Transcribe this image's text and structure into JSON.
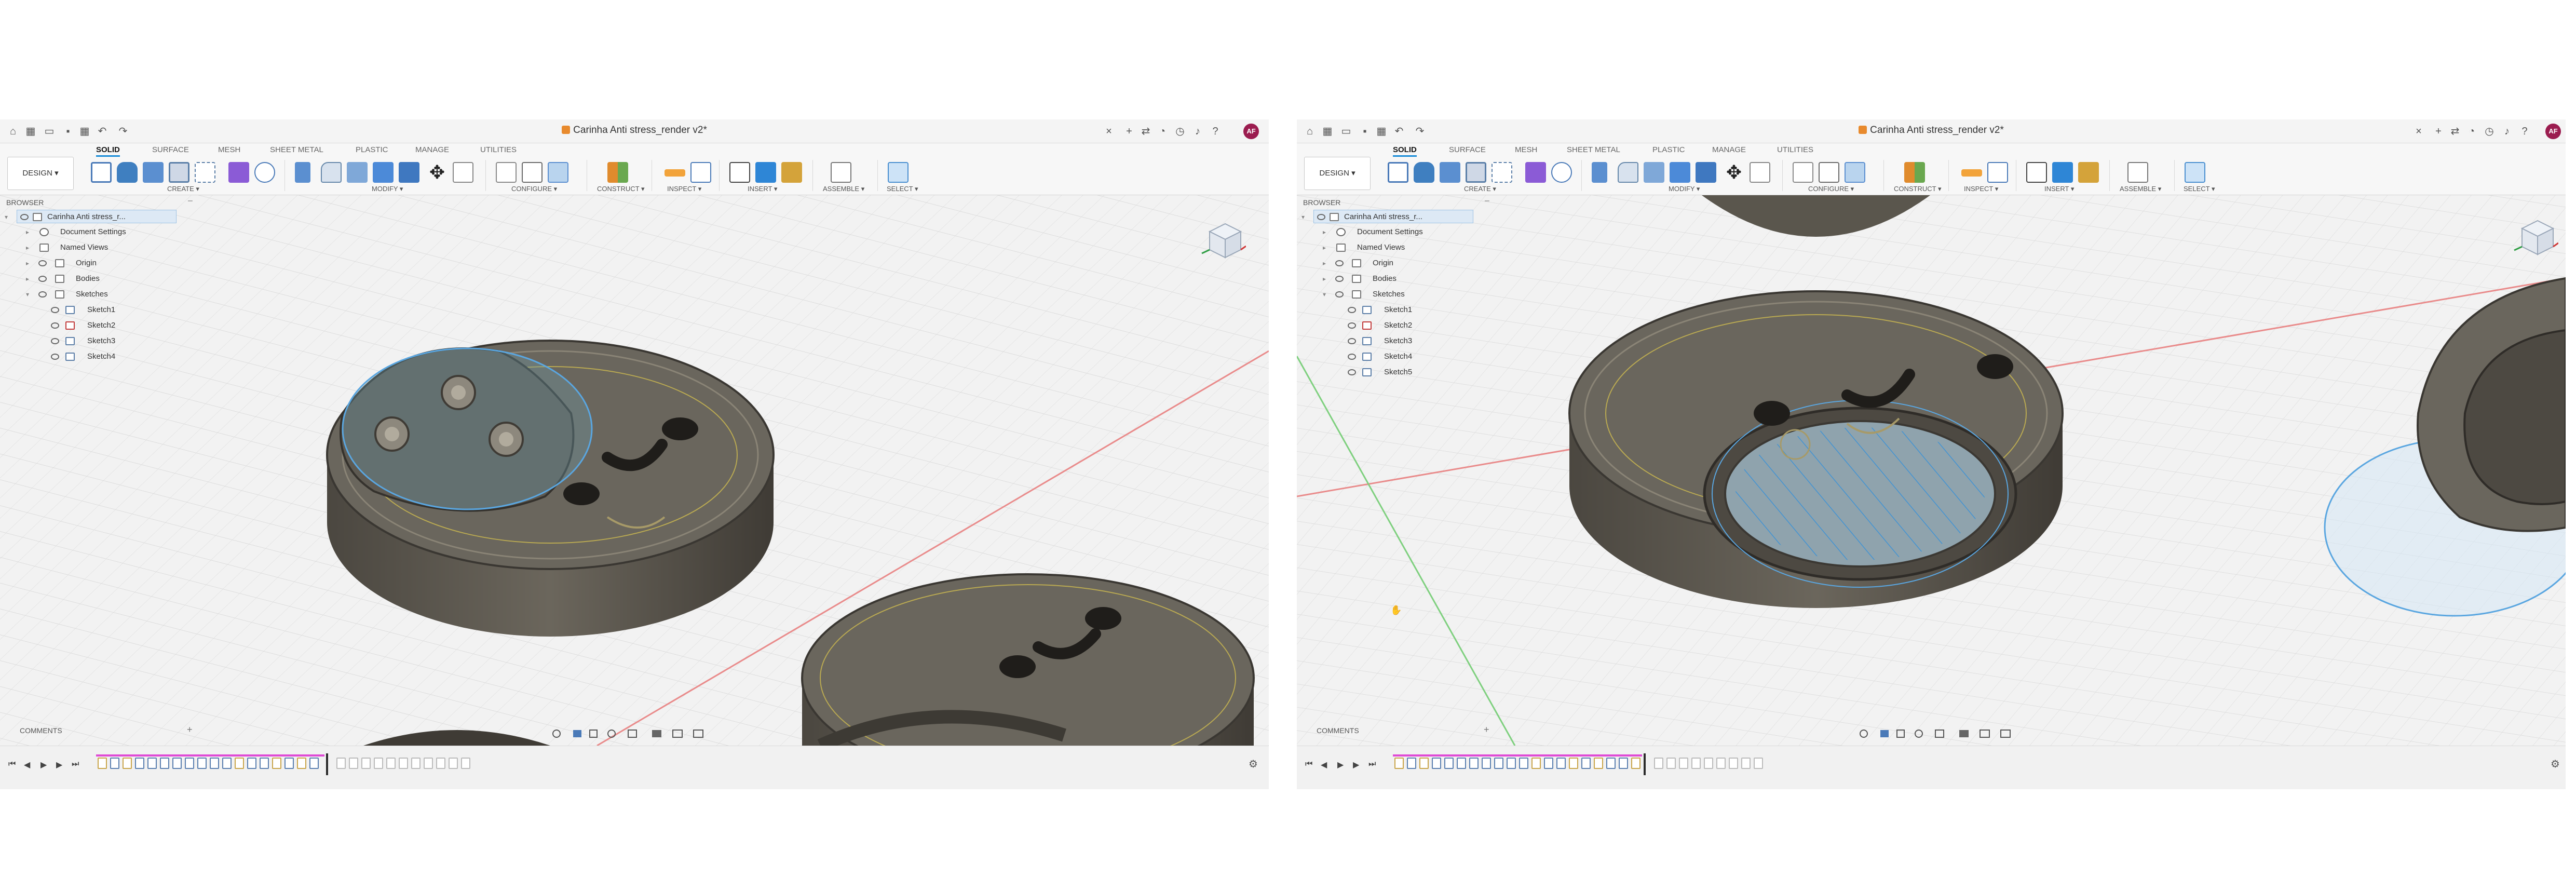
{
  "document_title": "Carinha Anti stress_render v2*",
  "left": {
    "tabs": [
      "SOLID",
      "SURFACE",
      "MESH",
      "SHEET METAL",
      "PLASTIC",
      "MANAGE",
      "UTILITIES"
    ],
    "workspace": "DESIGN ▾",
    "groups": [
      "CREATE ▾",
      "MODIFY ▾",
      "CONFIGURE ▾",
      "CONSTRUCT ▾",
      "INSPECT ▾",
      "INSERT ▾",
      "ASSEMBLE ▾",
      "SELECT ▾"
    ],
    "browser_title": "BROWSER",
    "tree": [
      {
        "label": "Carinha Anti stress_r...",
        "kind": "root"
      },
      {
        "label": "Document Settings",
        "kind": "gear"
      },
      {
        "label": "Named Views",
        "kind": "folder"
      },
      {
        "label": "Origin",
        "kind": "folder"
      },
      {
        "label": "Bodies",
        "kind": "folder"
      },
      {
        "label": "Sketches",
        "kind": "folder"
      },
      {
        "label": "Sketch1",
        "kind": "sketch"
      },
      {
        "label": "Sketch2",
        "kind": "sketch"
      },
      {
        "label": "Sketch3",
        "kind": "sketch"
      },
      {
        "label": "Sketch4",
        "kind": "sketch"
      }
    ],
    "comments": "COMMENTS",
    "avatar": "AF"
  },
  "right": {
    "tabs": [
      "SOLID",
      "SURFACE",
      "MESH",
      "SHEET METAL",
      "PLASTIC",
      "MANAGE",
      "UTILITIES"
    ],
    "workspace": "DESIGN ▾",
    "groups": [
      "CREATE ▾",
      "MODIFY ▾",
      "CONFIGURE ▾",
      "CONSTRUCT ▾",
      "INSPECT ▾",
      "INSERT ▾",
      "ASSEMBLE ▾",
      "SELECT ▾"
    ],
    "browser_title": "BROWSER",
    "tree": [
      {
        "label": "Carinha Anti stress_r...",
        "kind": "root"
      },
      {
        "label": "Document Settings",
        "kind": "gear"
      },
      {
        "label": "Named Views",
        "kind": "folder"
      },
      {
        "label": "Origin",
        "kind": "folder"
      },
      {
        "label": "Bodies",
        "kind": "folder"
      },
      {
        "label": "Sketches",
        "kind": "folder"
      },
      {
        "label": "Sketch1",
        "kind": "sketch"
      },
      {
        "label": "Sketch2",
        "kind": "sketch"
      },
      {
        "label": "Sketch3",
        "kind": "sketch"
      },
      {
        "label": "Sketch4",
        "kind": "sketch"
      },
      {
        "label": "Sketch5",
        "kind": "sketch"
      }
    ],
    "comments": "COMMENTS",
    "avatar": "AF"
  },
  "colors": {
    "accent": "#1a8dd8",
    "timeline_progress": "#e04ad6",
    "model_body": "#5f5a4f",
    "avatar": "#9b1c4f",
    "selection": "#5aa6e0"
  },
  "icons": [
    "home-icon",
    "grid-icon",
    "file-icon",
    "save-icon",
    "undo-icon",
    "redo-icon",
    "close-icon",
    "plus-icon",
    "bell-icon",
    "help-icon",
    "gear-icon"
  ]
}
